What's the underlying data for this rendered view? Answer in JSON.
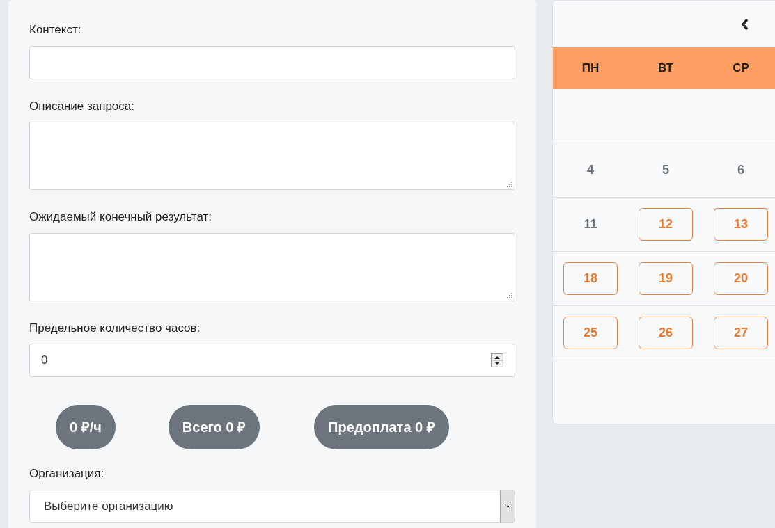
{
  "form": {
    "fields": [
      {
        "kind": "text",
        "label": "Контекст:"
      },
      {
        "kind": "textarea",
        "label": "Описание запроса:"
      },
      {
        "kind": "textarea",
        "label": "Ожидаемый конечный результат:"
      },
      {
        "kind": "number",
        "label": "Предельное количество часов:",
        "value": "0"
      }
    ],
    "badges": [
      "0 ₽/ч",
      "Всего 0 ₽",
      "Предоплата 0 ₽"
    ],
    "organization": {
      "label": "Организация:",
      "placeholder": "Выберите организацию"
    }
  },
  "calendar": {
    "weekdays": [
      "ПН",
      "ВТ",
      "СР"
    ],
    "weeks": [
      {
        "kind": "blank"
      },
      {
        "days": [
          {
            "day": "4",
            "available": false
          },
          {
            "day": "5",
            "available": false
          },
          {
            "day": "6",
            "available": false
          }
        ]
      },
      {
        "days": [
          {
            "day": "11",
            "available": false
          },
          {
            "day": "12",
            "available": true
          },
          {
            "day": "13",
            "available": true
          }
        ]
      },
      {
        "days": [
          {
            "day": "18",
            "available": true
          },
          {
            "day": "19",
            "available": true
          },
          {
            "day": "20",
            "available": true
          }
        ]
      },
      {
        "days": [
          {
            "day": "25",
            "available": true
          },
          {
            "day": "26",
            "available": true
          },
          {
            "day": "27",
            "available": true
          }
        ]
      }
    ]
  }
}
